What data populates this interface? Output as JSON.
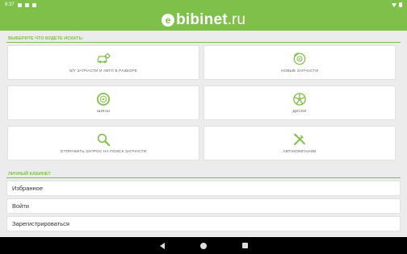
{
  "status_bar": {
    "time": "8:37"
  },
  "app": {
    "logo_mark": "e",
    "logo_name": "bibinet",
    "logo_tld": ".ru",
    "accent": "#7fc04a"
  },
  "search_section": {
    "title": "ВЫБЕРИТЕ ЧТО БУДЕТЕ ИСКАТЬ:",
    "tiles": [
      {
        "label": "Б/У ЗАПЧАСТИ И АВТО В РАЗБОРЕ",
        "icon": "car-parts-icon"
      },
      {
        "label": "НОВЫЕ ЗАПЧАСТИ",
        "icon": "brake-disc-icon"
      },
      {
        "label": "ШИНЫ",
        "icon": "tire-icon"
      },
      {
        "label": "ДИСКИ",
        "icon": "wheel-rim-icon"
      },
      {
        "label": "ОТПРАВИТЬ ЗАПРОС НА ПОИСК ЗАПЧАСТИ",
        "icon": "search-icon"
      },
      {
        "label": "АВТОКОМПАНИИ",
        "icon": "tools-icon"
      }
    ]
  },
  "account_section": {
    "title": "ЛИЧНЫЙ КАБИНЕТ",
    "items": [
      {
        "label": "Избранное"
      },
      {
        "label": "Войти"
      },
      {
        "label": "Зарегистрироваться"
      }
    ]
  }
}
